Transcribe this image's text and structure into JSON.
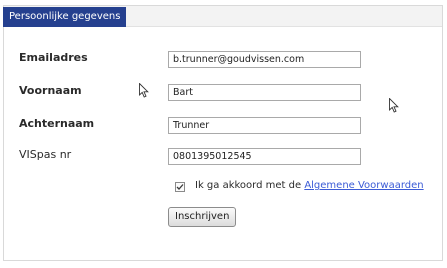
{
  "form": {
    "title": "Persoonlijke gegevens",
    "fields": [
      {
        "label": "Emailadres",
        "value": "b.trunner@goudvissen.com"
      },
      {
        "label": "Voornaam",
        "value": "Bart"
      },
      {
        "label": "Achternaam",
        "value": "Trunner"
      },
      {
        "label": "VISpas nr",
        "value": "0801395012545"
      }
    ],
    "agree": {
      "checked": true,
      "text": "Ik ga akkoord met de",
      "link": "Algemene Voorwaarden"
    },
    "submit_label": "Inschrijven"
  },
  "colors": {
    "header_bg": "#25408f",
    "link": "#3b5bd6"
  },
  "icons": [
    "checkmark-icon",
    "mouse-pointer-icon"
  ]
}
